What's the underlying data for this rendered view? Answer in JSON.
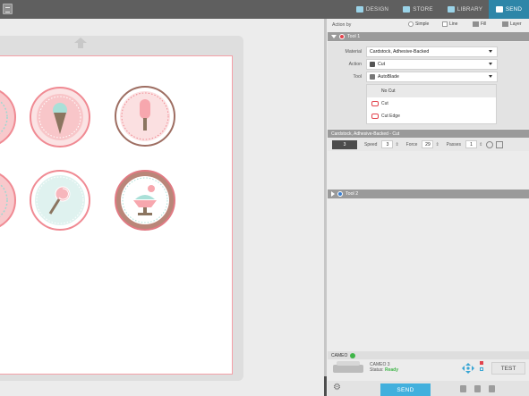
{
  "tabs": [
    {
      "label": "DESIGN",
      "icon": "design-icon"
    },
    {
      "label": "STORE",
      "icon": "store-icon"
    },
    {
      "label": "LIBRARY",
      "icon": "library-icon"
    },
    {
      "label": "SEND",
      "icon": "send-icon",
      "active": true
    }
  ],
  "action_by": {
    "label": "Action by",
    "modes": [
      "Simple",
      "Line",
      "Fill",
      "Layer"
    ]
  },
  "tool1": {
    "title": "Tool 1",
    "material_label": "Material",
    "material_value": "Cardstock, Adhesive-Backed",
    "action_label": "Action",
    "action_value": "Cut",
    "tool_label": "Tool",
    "tool_value": "AutoBlade",
    "cut_options": [
      "No Cut",
      "Cut",
      "Cut Edge"
    ]
  },
  "blade_settings": {
    "header": "Cardstock, Adhesive-Backed - Cut",
    "blade_value": "3",
    "speed_label": "Speed",
    "speed_value": "3",
    "force_label": "Force",
    "force_value": "29",
    "passes_label": "Passes",
    "passes_value": "1"
  },
  "tool2": {
    "title": "Tool 2"
  },
  "machine": {
    "bar_label": "CAMEO",
    "name": "CAMEO 3",
    "status_label": "Status:",
    "status_value": "Ready",
    "test_label": "TEST"
  },
  "send_label": "SEND",
  "colors": {
    "accent": "#2e86a8",
    "send": "#42b0dd",
    "cut_line": "#f4a0a8",
    "ready": "#3fb548"
  },
  "designs": [
    "ice-cream-cone-icon",
    "popsicle-icon",
    "lollipop-icon",
    "sundae-icon"
  ]
}
